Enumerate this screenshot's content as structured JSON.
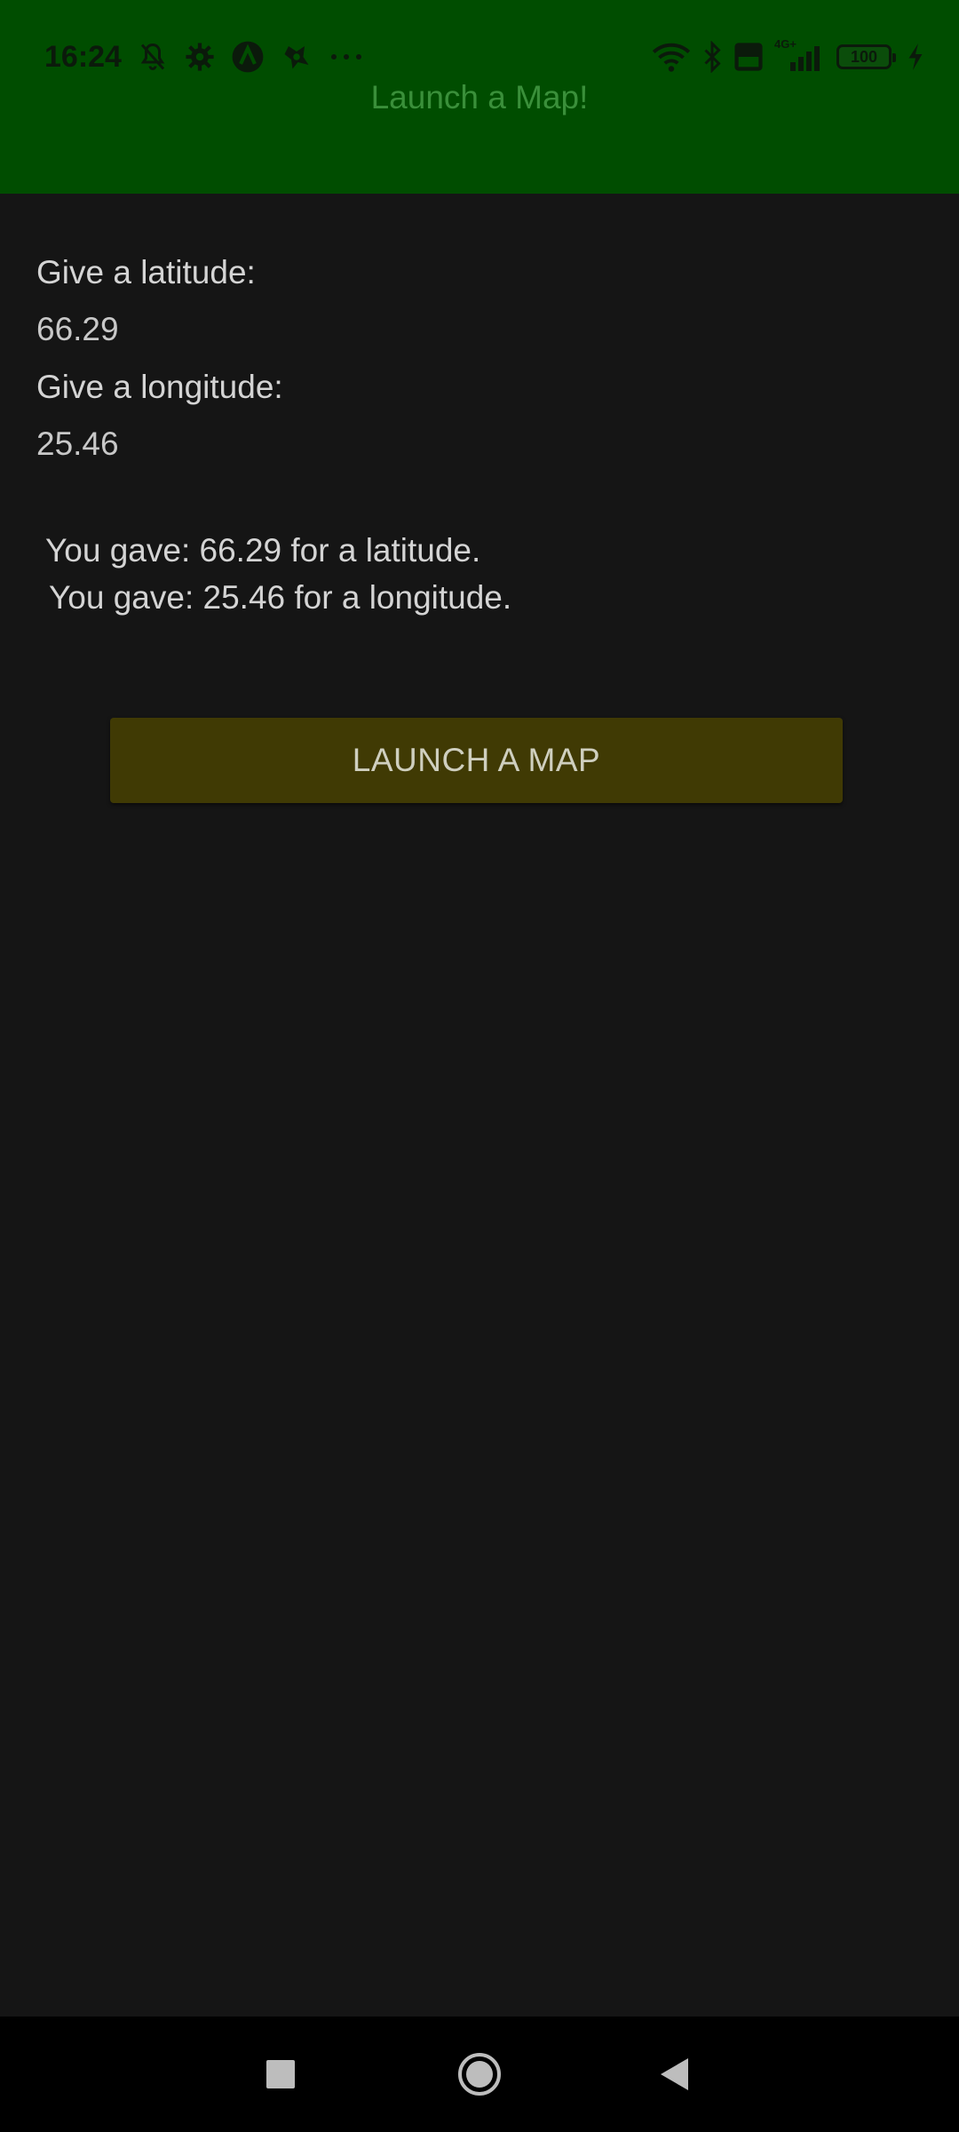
{
  "status_bar": {
    "time": "16:24",
    "left_icons": [
      "mute-bell-icon",
      "gear-icon",
      "app-a-icon",
      "app-badge-icon",
      "more-dots-icon"
    ],
    "right_icons": [
      "wifi-icon",
      "bluetooth-icon",
      "volte-icon",
      "signal-4g-icon",
      "battery-icon",
      "charging-icon"
    ],
    "network_label": "4G+",
    "volte_label": "Vo LTE",
    "battery_level": "100"
  },
  "app_bar": {
    "title": "Launch a Map!"
  },
  "form": {
    "latitude_label": "Give a latitude:",
    "latitude_value": "66.29",
    "longitude_label": "Give a longitude:",
    "longitude_value": "25.46"
  },
  "result": {
    "latitude_text": "You gave: 66.29 for a latitude.",
    "longitude_text": "You gave: 25.46 for a longitude."
  },
  "actions": {
    "launch_label": "LAUNCH A MAP"
  },
  "colors": {
    "header_bg": "#004d00",
    "title_text": "#3a8f3a",
    "screen_bg": "#151515",
    "button_bg": "#403a04",
    "navbar_bg": "#000000"
  },
  "navbar": {
    "buttons": [
      "recents-square-icon",
      "home-circle-icon",
      "back-triangle-icon"
    ]
  }
}
